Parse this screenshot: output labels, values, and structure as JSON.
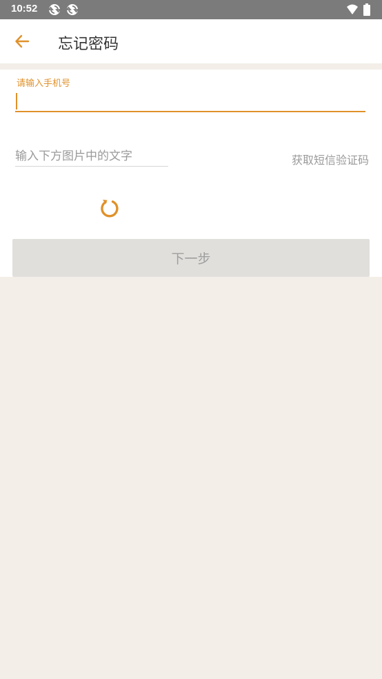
{
  "status_bar": {
    "time": "10:52",
    "notification_icons": [
      "sync-icon",
      "sync-icon"
    ],
    "right_icons": [
      "wifi-icon",
      "battery-icon"
    ]
  },
  "header": {
    "back_icon": "arrow-left-icon",
    "title": "忘记密码"
  },
  "form": {
    "phone_label": "请输入手机号",
    "phone_value": "",
    "captcha_placeholder": "输入下方图片中的文字",
    "captcha_value": "",
    "sms_link": "获取短信验证码",
    "refresh_icon": "refresh-icon",
    "next_button": "下一步"
  },
  "colors": {
    "accent": "#e0912a",
    "status_bar": "#7b7b7b",
    "background": "#f3efe8",
    "button_disabled": "#e0dfdc"
  }
}
